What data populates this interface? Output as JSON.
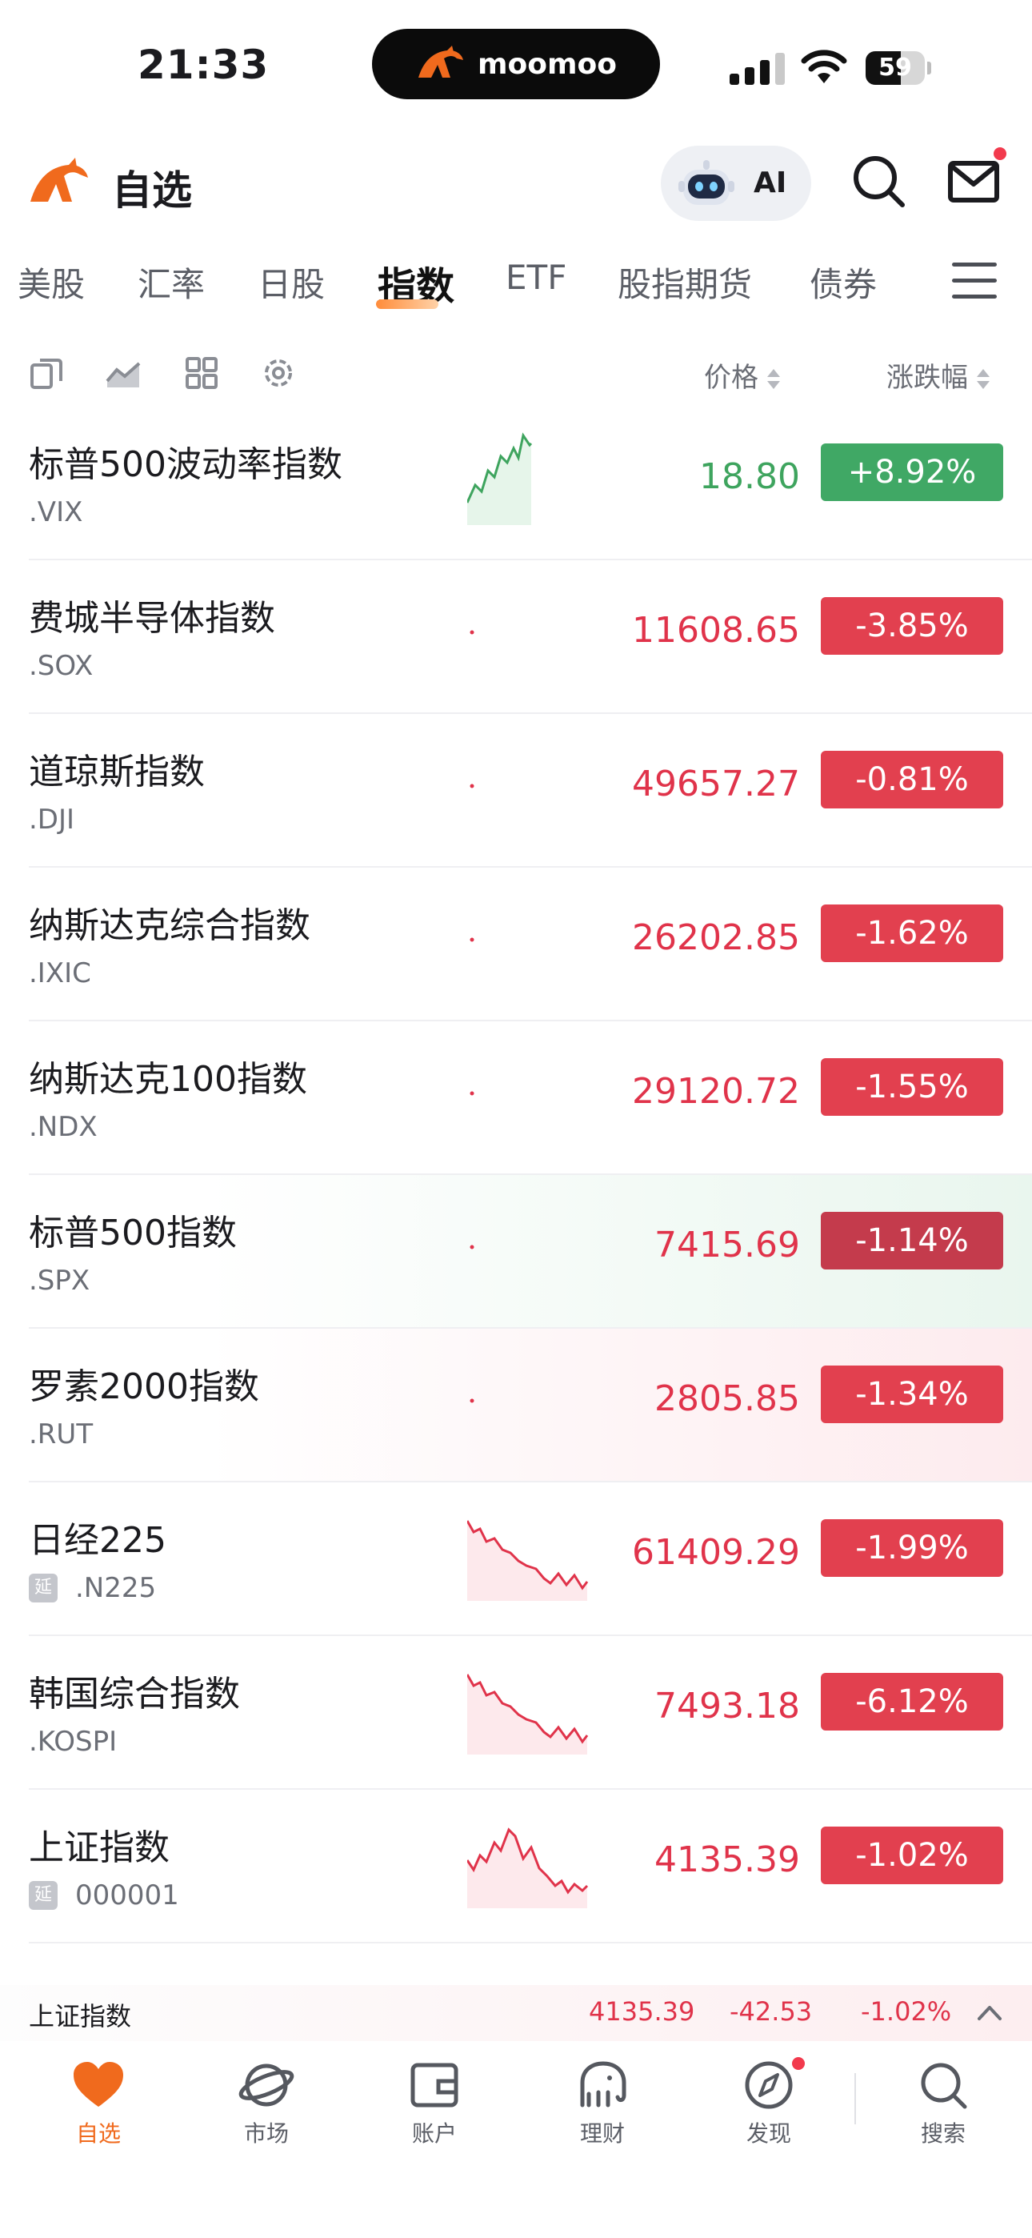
{
  "status": {
    "time": "21:33",
    "battery": "59",
    "battery_level": 0.59,
    "island_brand": "moomoo"
  },
  "header": {
    "title": "自选",
    "ai_label": "AI"
  },
  "tabs": [
    {
      "label": "美股"
    },
    {
      "label": "汇率"
    },
    {
      "label": "日股"
    },
    {
      "label": "指数",
      "active": true
    },
    {
      "label": "ETF"
    },
    {
      "label": "股指期货"
    },
    {
      "label": "债券"
    }
  ],
  "columns": {
    "price": "价格",
    "change": "涨跌幅"
  },
  "rows": [
    {
      "name": "标普500波动率指数",
      "code": ".VIX",
      "price": "18.80",
      "change": "+8.92%",
      "trend": "up",
      "spark": "up"
    },
    {
      "name": "费城半导体指数",
      "code": ".SOX",
      "price": "11608.65",
      "change": "-3.85%",
      "trend": "down",
      "spark": "dot"
    },
    {
      "name": "道琼斯指数",
      "code": ".DJI",
      "price": "49657.27",
      "change": "-0.81%",
      "trend": "down",
      "spark": "dot"
    },
    {
      "name": "纳斯达克综合指数",
      "code": ".IXIC",
      "price": "26202.85",
      "change": "-1.62%",
      "trend": "down",
      "spark": "dot"
    },
    {
      "name": "纳斯达克100指数",
      "code": ".NDX",
      "price": "29120.72",
      "change": "-1.55%",
      "trend": "down",
      "spark": "dot"
    },
    {
      "name": "标普500指数",
      "code": ".SPX",
      "price": "7415.69",
      "change": "-1.14%",
      "trend": "down",
      "spark": "dot",
      "highlight": "pos"
    },
    {
      "name": "罗素2000指数",
      "code": ".RUT",
      "price": "2805.85",
      "change": "-1.34%",
      "trend": "down",
      "spark": "dot",
      "highlight": "neg"
    },
    {
      "name": "日经225",
      "code": ".N225",
      "delayed": true,
      "price": "61409.29",
      "change": "-1.99%",
      "trend": "down",
      "spark": "down"
    },
    {
      "name": "韩国综合指数",
      "code": ".KOSPI",
      "price": "7493.18",
      "change": "-6.12%",
      "trend": "down",
      "spark": "down"
    },
    {
      "name": "上证指数",
      "code": "000001",
      "delayed": true,
      "price": "4135.39",
      "change": "-1.02%",
      "trend": "down",
      "spark": "wave"
    }
  ],
  "delayed_badge": "延",
  "ticker": {
    "name": "上证指数",
    "price": "4135.39",
    "change": "-42.53",
    "change_pct": "-1.02%"
  },
  "nav": [
    {
      "label": "自选",
      "icon": "heart-icon",
      "active": true
    },
    {
      "label": "市场",
      "icon": "planet-icon"
    },
    {
      "label": "账户",
      "icon": "wallet-icon"
    },
    {
      "label": "理财",
      "icon": "elephant-icon"
    },
    {
      "label": "发现",
      "icon": "compass-icon",
      "badge": true
    },
    {
      "label": "搜索",
      "icon": "search-icon"
    }
  ],
  "colors": {
    "brand": "#f06a1d",
    "up": "#40a865",
    "down": "#e2404f"
  }
}
